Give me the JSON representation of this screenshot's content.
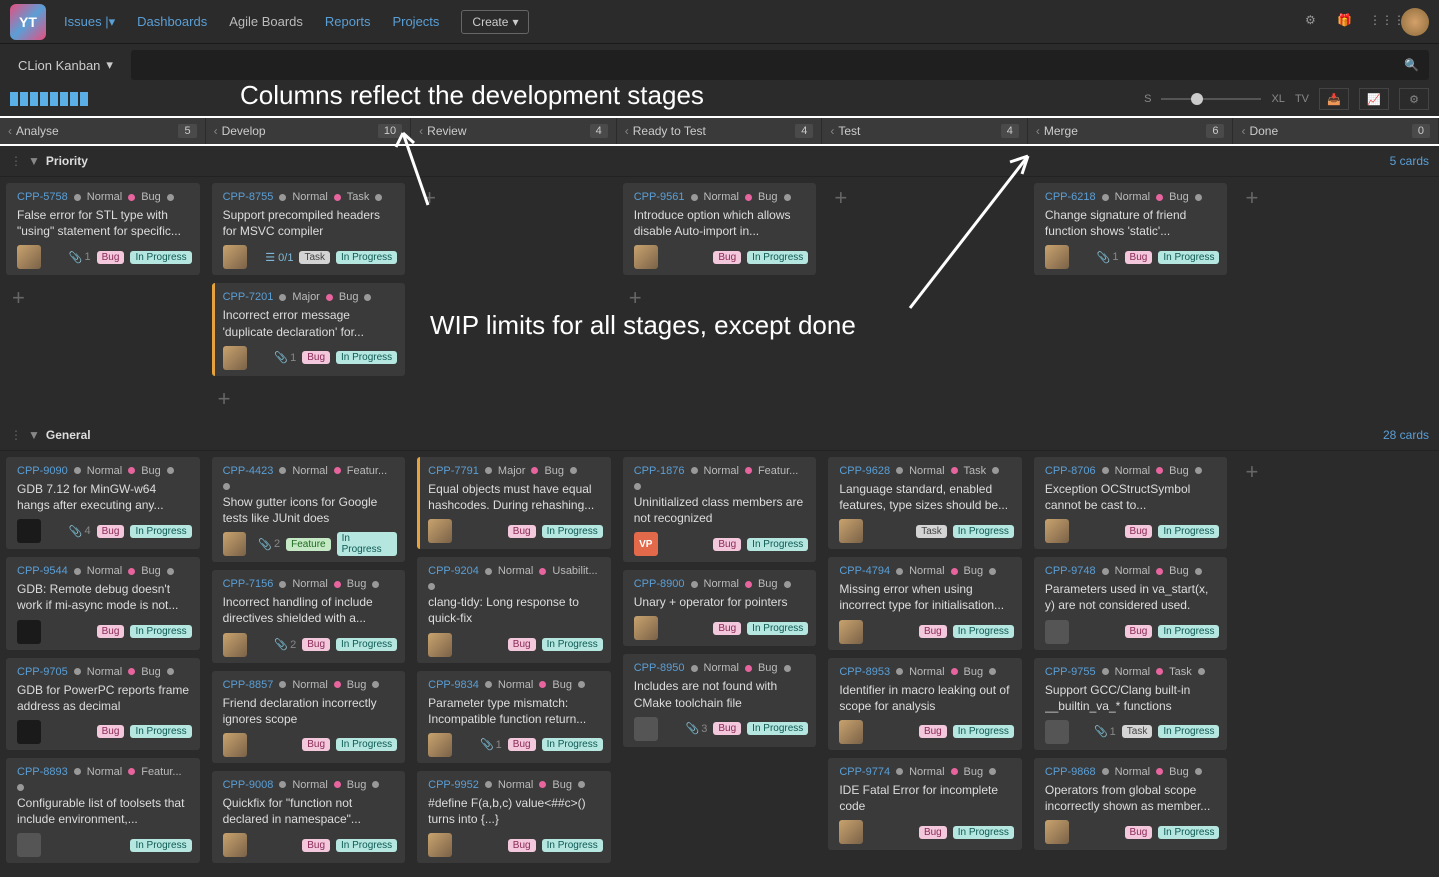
{
  "nav": {
    "issues": "Issues",
    "dashboards": "Dashboards",
    "agile": "Agile Boards",
    "reports": "Reports",
    "projects": "Projects",
    "create": "Create"
  },
  "board": {
    "name": "CLion Kanban"
  },
  "size": {
    "s": "S",
    "xl": "XL",
    "tv": "TV"
  },
  "annotations": {
    "columns": "Columns reflect the development stages",
    "wip": "WIP limits for all stages, except done"
  },
  "columns": [
    {
      "name": "Analyse",
      "wip": "5"
    },
    {
      "name": "Develop",
      "wip": "10"
    },
    {
      "name": "Review",
      "wip": "4"
    },
    {
      "name": "Ready to Test",
      "wip": "4"
    },
    {
      "name": "Test",
      "wip": "4"
    },
    {
      "name": "Merge",
      "wip": "6"
    },
    {
      "name": "Done",
      "wip": "0"
    }
  ],
  "lanes": [
    {
      "name": "Priority",
      "count": "5 cards",
      "cols": [
        [
          {
            "id": "CPP-5758",
            "prio": "Normal",
            "type": "Bug",
            "title": "False error for STL type with \"using\" statement for specific...",
            "avatar": "a",
            "attach": "1",
            "tags": [
              "Bug",
              "In Progress"
            ]
          }
        ],
        [
          {
            "id": "CPP-8755",
            "prio": "Normal",
            "type": "Task",
            "title": "Support precompiled headers for MSVC compiler",
            "avatar": "b",
            "subtask": "0/1",
            "tags": [
              "Task",
              "In Progress"
            ]
          },
          {
            "id": "CPP-7201",
            "prio": "Major",
            "type": "Bug",
            "major": true,
            "title": "Incorrect error message 'duplicate declaration' for...",
            "avatar": "a",
            "attach": "1",
            "tags": [
              "Bug",
              "In Progress"
            ]
          }
        ],
        [],
        [
          {
            "id": "CPP-9561",
            "prio": "Normal",
            "type": "Bug",
            "title": "Introduce option which allows disable Auto-import in...",
            "avatar": "b",
            "tags": [
              "Bug",
              "In Progress"
            ]
          }
        ],
        [],
        [
          {
            "id": "CPP-6218",
            "prio": "Normal",
            "type": "Bug",
            "title": "Change signature of friend function shows 'static'...",
            "avatar": "a",
            "attach": "1",
            "tags": [
              "Bug",
              "In Progress"
            ]
          }
        ],
        []
      ]
    },
    {
      "name": "General",
      "count": "28 cards",
      "cols": [
        [
          {
            "id": "CPP-9090",
            "prio": "Normal",
            "type": "Bug",
            "title": "GDB 7.12 for MinGW-w64 hangs after executing any...",
            "avatar": "dark",
            "attach": "4",
            "tags": [
              "Bug",
              "In Progress"
            ]
          },
          {
            "id": "CPP-9544",
            "prio": "Normal",
            "type": "Bug",
            "title": "GDB: Remote debug doesn't work if mi-async mode is not...",
            "avatar": "dark",
            "tags": [
              "Bug",
              "In Progress"
            ]
          },
          {
            "id": "CPP-9705",
            "prio": "Normal",
            "type": "Bug",
            "title": "GDB for PowerPC reports frame address as decimal",
            "avatar": "dark",
            "tags": [
              "Bug",
              "In Progress"
            ]
          },
          {
            "id": "CPP-8893",
            "prio": "Normal",
            "type": "Featur...",
            "title": "Configurable list of toolsets that include environment,...",
            "avatar": "blank",
            "tags": [
              "",
              "In Progress"
            ]
          }
        ],
        [
          {
            "id": "CPP-4423",
            "prio": "Normal",
            "type": "Featur...",
            "title": "Show gutter icons for Google tests like JUnit does",
            "avatar": "b",
            "attach": "2",
            "tags": [
              "Feature",
              "In Progress"
            ]
          },
          {
            "id": "CPP-7156",
            "prio": "Normal",
            "type": "Bug",
            "title": "Incorrect handling of include directives shielded with a...",
            "avatar": "a",
            "attach": "2",
            "tags": [
              "Bug",
              "In Progress"
            ]
          },
          {
            "id": "CPP-8857",
            "prio": "Normal",
            "type": "Bug",
            "title": "Friend declaration incorrectly ignores scope",
            "avatar": "a",
            "tags": [
              "Bug",
              "In Progress"
            ]
          },
          {
            "id": "CPP-9008",
            "prio": "Normal",
            "type": "Bug",
            "title": "Quickfix for \"function not declared in namespace\"...",
            "avatar": "a",
            "tags": [
              "Bug",
              "In Progress"
            ]
          }
        ],
        [
          {
            "id": "CPP-7791",
            "prio": "Major",
            "type": "Bug",
            "major": true,
            "title": "Equal objects must have equal hashcodes. During rehashing...",
            "avatar": "c",
            "tags": [
              "Bug",
              "In Progress"
            ]
          },
          {
            "id": "CPP-9204",
            "prio": "Normal",
            "type": "Usabilit...",
            "title": "clang-tidy: Long response to quick-fix",
            "avatar": "c",
            "tags": [
              "Bug",
              "In Progress"
            ]
          },
          {
            "id": "CPP-9834",
            "prio": "Normal",
            "type": "Bug",
            "title": "Parameter type mismatch: Incompatible function return...",
            "avatar": "c",
            "attach": "1",
            "tags": [
              "Bug",
              "In Progress"
            ]
          },
          {
            "id": "CPP-9952",
            "prio": "Normal",
            "type": "Bug",
            "title": "#define F(a,b,c) value<##c>() turns into {...}",
            "avatar": "a",
            "tags": [
              "Bug",
              "In Progress"
            ]
          }
        ],
        [
          {
            "id": "CPP-1876",
            "prio": "Normal",
            "type": "Featur...",
            "title": "Uninitialized class members are not recognized",
            "avatar": "vp",
            "tags": [
              "Bug",
              "In Progress"
            ]
          },
          {
            "id": "CPP-8900",
            "prio": "Normal",
            "type": "Bug",
            "title": "Unary + operator for pointers",
            "avatar": "b",
            "tags": [
              "Bug",
              "In Progress"
            ]
          },
          {
            "id": "CPP-8950",
            "prio": "Normal",
            "type": "Bug",
            "title": "Includes are not found with CMake toolchain file",
            "avatar": "blank",
            "attach": "3",
            "tags": [
              "Bug",
              "In Progress"
            ]
          }
        ],
        [
          {
            "id": "CPP-9628",
            "prio": "Normal",
            "type": "Task",
            "title": "Language standard, enabled features, type sizes should be...",
            "avatar": "b",
            "tags": [
              "Task",
              "In Progress"
            ]
          },
          {
            "id": "CPP-4794",
            "prio": "Normal",
            "type": "Bug",
            "title": "Missing error when using incorrect type for initialisation...",
            "avatar": "a",
            "tags": [
              "Bug",
              "In Progress"
            ]
          },
          {
            "id": "CPP-8953",
            "prio": "Normal",
            "type": "Bug",
            "title": "Identifier in macro leaking out of scope for analysis",
            "avatar": "d",
            "tags": [
              "Bug",
              "In Progress"
            ]
          },
          {
            "id": "CPP-9774",
            "prio": "Normal",
            "type": "Bug",
            "title": "IDE Fatal Error for incomplete code",
            "avatar": "b",
            "tags": [
              "Bug",
              "In Progress"
            ]
          }
        ],
        [
          {
            "id": "CPP-8706",
            "prio": "Normal",
            "type": "Bug",
            "title": "Exception OCStructSymbol cannot be cast to...",
            "avatar": "a",
            "tags": [
              "Bug",
              "In Progress"
            ]
          },
          {
            "id": "CPP-9748",
            "prio": "Normal",
            "type": "Bug",
            "title": "Parameters used in va_start(x, y) are not considered used.",
            "avatar": "blank",
            "tags": [
              "Bug",
              "In Progress"
            ]
          },
          {
            "id": "CPP-9755",
            "prio": "Normal",
            "type": "Task",
            "title": "Support GCC/Clang built-in __builtin_va_* functions",
            "avatar": "blank",
            "attach": "1",
            "tags": [
              "Task",
              "In Progress"
            ]
          },
          {
            "id": "CPP-9868",
            "prio": "Normal",
            "type": "Bug",
            "title": "Operators from global scope incorrectly shown as member...",
            "avatar": "a",
            "tags": [
              "Bug",
              "In Progress"
            ]
          }
        ],
        []
      ]
    }
  ]
}
